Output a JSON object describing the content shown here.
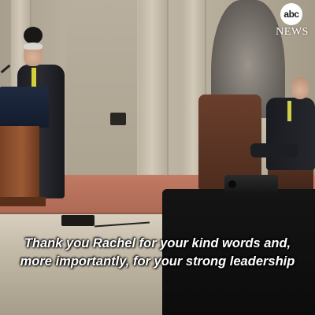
{
  "logo": {
    "abc": "abc",
    "news": "NEWS"
  },
  "captions": {
    "line1": "Thank you Rachel for your kind words and,",
    "line2": "more importantly, for your strong leadership"
  },
  "colors": {
    "caption_text": "#ffffff",
    "logo_bg": "#ffffff"
  }
}
